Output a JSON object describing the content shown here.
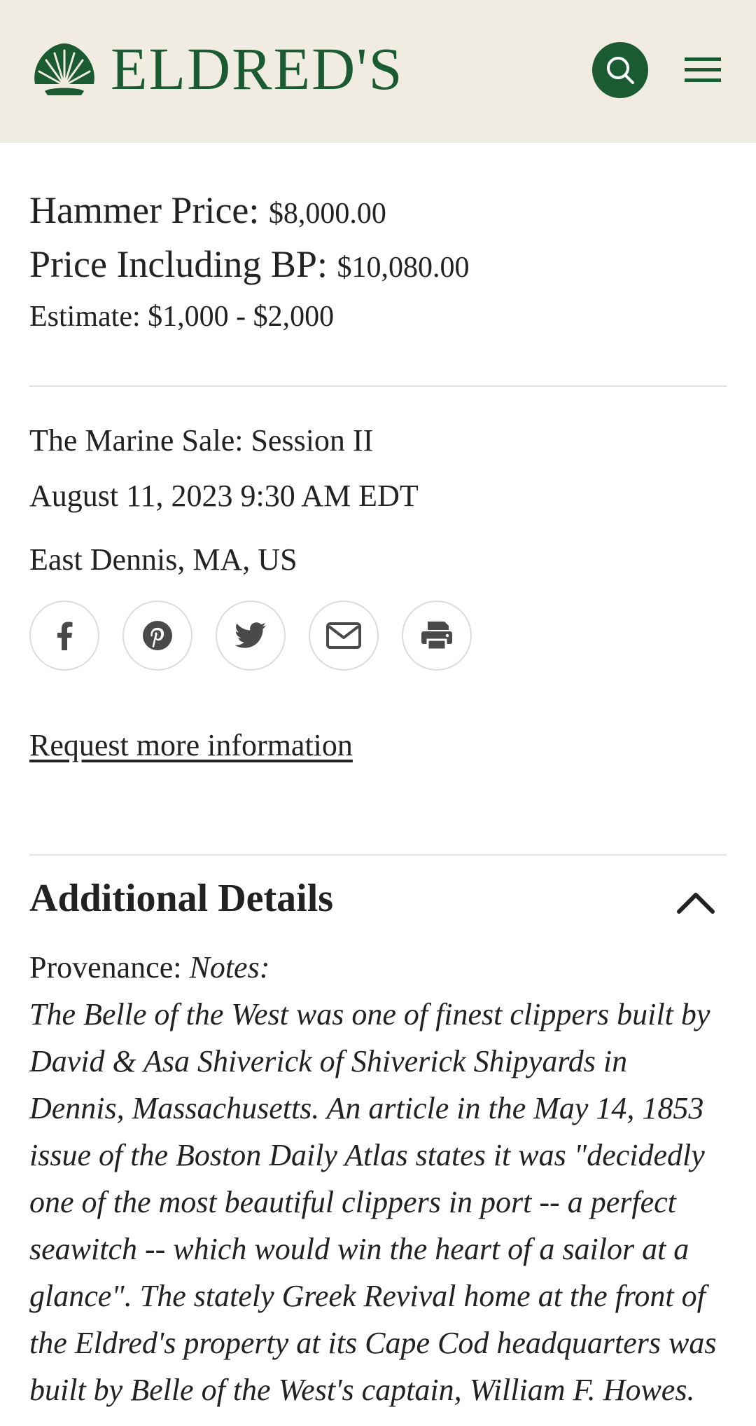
{
  "header": {
    "brand": "ELDRED'S",
    "search_icon": "search-icon",
    "menu_icon": "hamburger-menu-icon",
    "brand_color": "#1b5b32",
    "bg_color": "#f1ece2"
  },
  "lot": {
    "hammer_label": "Hammer Price:",
    "hammer_value": "$8,000.00",
    "bp_label": "Price Including BP:",
    "bp_value": "$10,080.00",
    "estimate": "Estimate: $1,000 - $2,000"
  },
  "sale": {
    "name": "The Marine Sale: Session II",
    "datetime": "August 11, 2023 9:30 AM EDT",
    "location": "East Dennis, MA, US"
  },
  "share": {
    "icons": [
      "facebook-icon",
      "pinterest-icon",
      "twitter-icon",
      "email-icon",
      "print-icon"
    ]
  },
  "request_link": "Request more information",
  "details": {
    "title": "Additional Details",
    "provenance_label": "Provenance:",
    "notes_label": "Notes:",
    "notes_text": "The Belle of the West was one of finest clippers built by David & Asa Shiverick of Shiverick Shipyards in Dennis, Massachusetts. An article in the May 14, 1853 issue of the Boston Daily Atlas states it was \"decidedly one of the most beautiful clippers in port -- a perfect seawitch -- which would win the heart of a sailor at a glance\". The stately Greek Revival home at the front of the Eldred's property at its Cape Cod headquarters was built by Belle of the West's captain, William F. Howes."
  }
}
